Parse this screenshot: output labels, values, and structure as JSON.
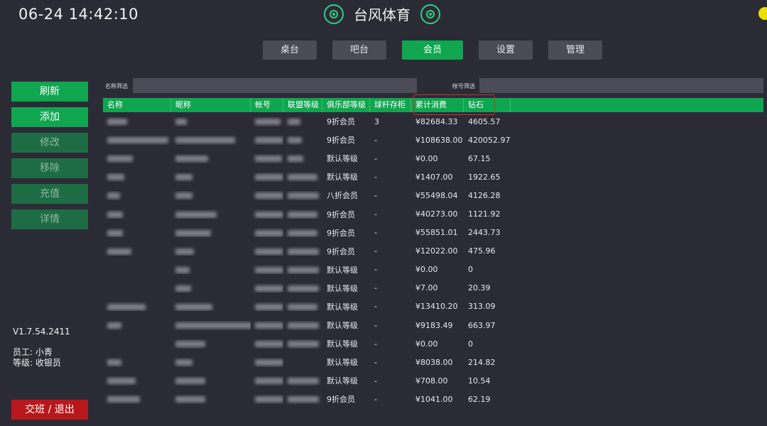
{
  "header": {
    "clock": "06-24 14:42:10",
    "brand": "台风体育",
    "accent": "#0fa64f",
    "status_color": "#e8e000"
  },
  "tabs": [
    {
      "label": "桌台",
      "active": false
    },
    {
      "label": "吧台",
      "active": false
    },
    {
      "label": "会员",
      "active": true
    },
    {
      "label": "设置",
      "active": false
    },
    {
      "label": "管理",
      "active": false
    }
  ],
  "sidebar": {
    "refresh": "刷新",
    "add": "添加",
    "edit": "修改",
    "remove": "移除",
    "recharge": "充值",
    "details": "详情",
    "version": "V1.7.54.2411",
    "staff": "员工: 小青",
    "staff_level": "等级: 收银员",
    "logout": "交班 / 退出"
  },
  "filters": {
    "name_label": "名称筛选",
    "account_label": "帐号筛选",
    "name_value": "",
    "account_value": ""
  },
  "columns": [
    "名称",
    "昵称",
    "帐号",
    "联盟等级",
    "俱乐部等级",
    "球杆存柜",
    "累计消费",
    "钻石"
  ],
  "rows": [
    {
      "level": "9折会员",
      "locker": "3",
      "total": "¥82684.33",
      "diamond": "4605.57"
    },
    {
      "level": "9折会员",
      "locker": "-",
      "total": "¥108638.00",
      "diamond": "420052.97"
    },
    {
      "level": "默认等级",
      "locker": "-",
      "total": "¥0.00",
      "diamond": "67.15"
    },
    {
      "level": "默认等级",
      "locker": "-",
      "total": "¥1407.00",
      "diamond": "1922.65"
    },
    {
      "level": "八折会员",
      "locker": "-",
      "total": "¥55498.04",
      "diamond": "4126.28"
    },
    {
      "level": "9折会员",
      "locker": "-",
      "total": "¥40273.00",
      "diamond": "1121.92"
    },
    {
      "level": "9折会员",
      "locker": "-",
      "total": "¥55851.01",
      "diamond": "2443.73"
    },
    {
      "level": "9折会员",
      "locker": "-",
      "total": "¥12022.00",
      "diamond": "475.96"
    },
    {
      "level": "默认等级",
      "locker": "-",
      "total": "¥0.00",
      "diamond": "0"
    },
    {
      "level": "默认等级",
      "locker": "-",
      "total": "¥7.00",
      "diamond": "20.39"
    },
    {
      "level": "默认等级",
      "locker": "-",
      "total": "¥13410.20",
      "diamond": "313.09"
    },
    {
      "level": "默认等级",
      "locker": "-",
      "total": "¥9183.49",
      "diamond": "663.97"
    },
    {
      "level": "默认等级",
      "locker": "-",
      "total": "¥0.00",
      "diamond": "0"
    },
    {
      "level": "默认等级",
      "locker": "-",
      "total": "¥8038.00",
      "diamond": "214.82"
    },
    {
      "level": "默认等级",
      "locker": "-",
      "total": "¥708.00",
      "diamond": "10.54"
    },
    {
      "level": "9折会员",
      "locker": "-",
      "total": "¥1041.00",
      "diamond": "62.19"
    }
  ]
}
